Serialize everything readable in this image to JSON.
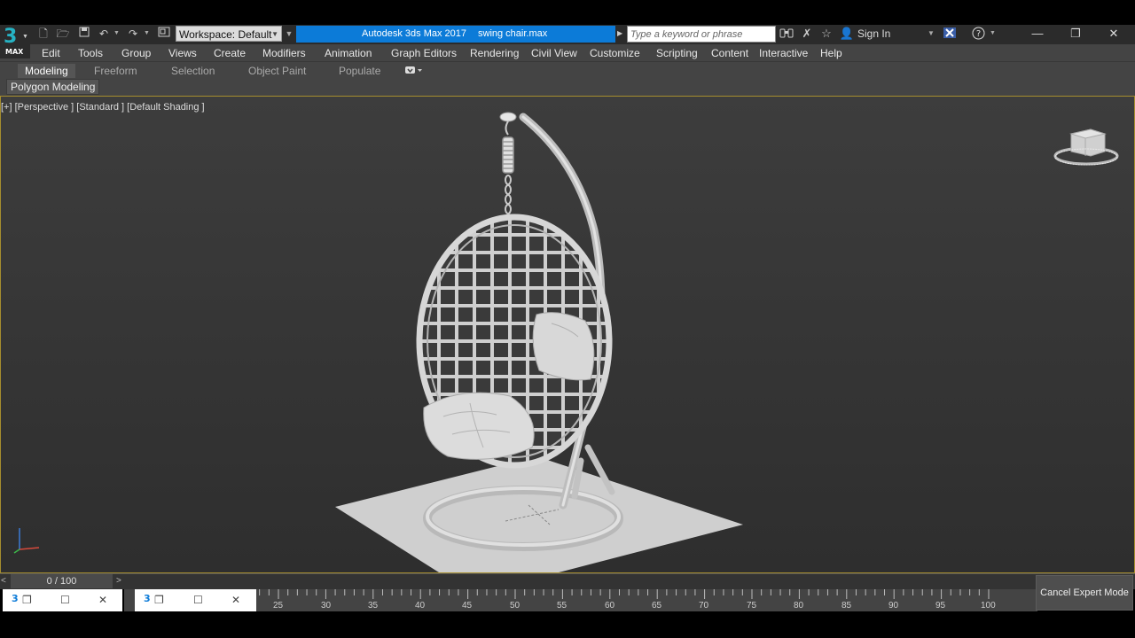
{
  "app": {
    "logo_number": "3",
    "logo_text": "MAX",
    "title_app": "Autodesk 3ds Max 2017",
    "title_file": "swing chair.max"
  },
  "quick_access": {
    "workspace_label": "Workspace: Default"
  },
  "search": {
    "placeholder": "Type a keyword or phrase"
  },
  "account": {
    "sign_in_label": "Sign In"
  },
  "menu": {
    "items": [
      "Edit",
      "Tools",
      "Group",
      "Views",
      "Create",
      "Modifiers",
      "Animation",
      "Graph Editors",
      "Rendering",
      "Civil View",
      "Customize",
      "Scripting",
      "Content",
      "Interactive",
      "Help"
    ]
  },
  "ribbon": {
    "tabs": [
      "Modeling",
      "Freeform",
      "Selection",
      "Object Paint",
      "Populate"
    ],
    "active_tab": "Modeling",
    "sub_tab": "Polygon Modeling"
  },
  "viewport": {
    "label": "[+] [Perspective ] [Standard ] [Default Shading ]"
  },
  "timeline": {
    "frame_display": "0 / 100",
    "current_frame": 0,
    "total_frames": 100,
    "tick_labels": [
      "25",
      "30",
      "35",
      "40",
      "45",
      "50",
      "55",
      "60",
      "65",
      "70",
      "75",
      "80",
      "85",
      "90",
      "95",
      "100"
    ]
  },
  "status": {
    "cancel_expert_mode": "Cancel Expert Mode"
  },
  "colors": {
    "title_accent": "#0c7bd8",
    "logo": "#26b3c4",
    "viewport_border": "#a58d2e"
  }
}
